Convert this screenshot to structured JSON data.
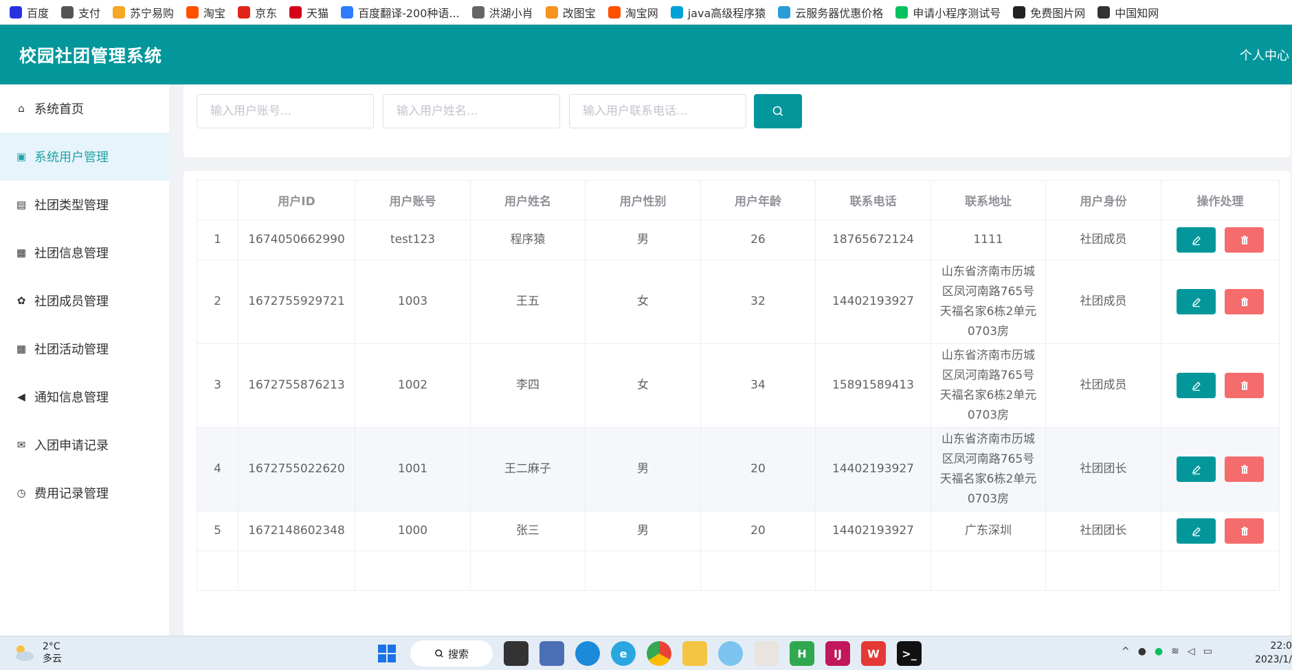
{
  "bookmarks": [
    {
      "label": "百度",
      "icon": "baidu-paw-icon",
      "color": "#2932e1"
    },
    {
      "label": "支付",
      "icon": "globe-icon",
      "color": "#555555"
    },
    {
      "label": "苏宁易购",
      "icon": "suning-icon",
      "color": "#f5a623"
    },
    {
      "label": "淘宝",
      "icon": "taobao-icon",
      "color": "#ff5000"
    },
    {
      "label": "京东",
      "icon": "jd-icon",
      "color": "#e1251b"
    },
    {
      "label": "天猫",
      "icon": "tmall-icon",
      "color": "#d8001a"
    },
    {
      "label": "百度翻译-200种语...",
      "icon": "translate-icon",
      "color": "#2f7bfd"
    },
    {
      "label": "洪湖小肖",
      "icon": "feather-icon",
      "color": "#666666"
    },
    {
      "label": "改图宝",
      "icon": "gaitubao-icon",
      "color": "#f7931e"
    },
    {
      "label": "淘宝网",
      "icon": "taobao-icon",
      "color": "#ff5000"
    },
    {
      "label": "java高级程序猿",
      "icon": "bilibili-icon",
      "color": "#00a1d6"
    },
    {
      "label": "云服务器优惠价格",
      "icon": "cloud-icon",
      "color": "#2b9cd8"
    },
    {
      "label": "申请小程序测试号",
      "icon": "wechat-icon",
      "color": "#07c160"
    },
    {
      "label": "免费图片网",
      "icon": "t-logo-icon",
      "color": "#222222"
    },
    {
      "label": "中国知网",
      "icon": "cnki-icon",
      "color": "#333333"
    }
  ],
  "header": {
    "title": "校园社团管理系统",
    "user_center": "个人中心"
  },
  "sidebar": {
    "items": [
      {
        "label": "系统首页",
        "icon": "home-icon",
        "active": false
      },
      {
        "label": "系统用户管理",
        "icon": "user-card-icon",
        "active": true
      },
      {
        "label": "社团类型管理",
        "icon": "document-icon",
        "active": false
      },
      {
        "label": "社团信息管理",
        "icon": "monitor-icon",
        "active": false
      },
      {
        "label": "社团成员管理",
        "icon": "users-icon",
        "active": false
      },
      {
        "label": "社团活动管理",
        "icon": "calendar-icon",
        "active": false
      },
      {
        "label": "通知信息管理",
        "icon": "megaphone-icon",
        "active": false
      },
      {
        "label": "入团申请记录",
        "icon": "envelope-icon",
        "active": false
      },
      {
        "label": "费用记录管理",
        "icon": "clock-icon",
        "active": false
      }
    ]
  },
  "search": {
    "account_placeholder": "输入用户账号...",
    "name_placeholder": "输入用户姓名...",
    "phone_placeholder": "输入用户联系电话..."
  },
  "table": {
    "headers": [
      "",
      "用户ID",
      "用户账号",
      "用户姓名",
      "用户性别",
      "用户年龄",
      "联系电话",
      "联系地址",
      "用户身份",
      "操作处理"
    ],
    "rows": [
      {
        "index": "1",
        "id": "1674050662990",
        "account": "test123",
        "name": "程序猿",
        "gender": "男",
        "age": "26",
        "phone": "18765672124",
        "address": "1111",
        "role": "社团成员"
      },
      {
        "index": "2",
        "id": "1672755929721",
        "account": "1003",
        "name": "王五",
        "gender": "女",
        "age": "32",
        "phone": "14402193927",
        "address": "山东省济南市历城区凤河南路765号天福名家6栋2单元0703房",
        "role": "社团成员"
      },
      {
        "index": "3",
        "id": "1672755876213",
        "account": "1002",
        "name": "李四",
        "gender": "女",
        "age": "34",
        "phone": "15891589413",
        "address": "山东省济南市历城区凤河南路765号天福名家6栋2单元0703房",
        "role": "社团成员"
      },
      {
        "index": "4",
        "id": "1672755022620",
        "account": "1001",
        "name": "王二麻子",
        "gender": "男",
        "age": "20",
        "phone": "14402193927",
        "address": "山东省济南市历城区凤河南路765号天福名家6栋2单元0703房",
        "role": "社团团长"
      },
      {
        "index": "5",
        "id": "1672148602348",
        "account": "1000",
        "name": "张三",
        "gender": "男",
        "age": "20",
        "phone": "14402193927",
        "address": "广东深圳",
        "role": "社团团长"
      }
    ]
  },
  "taskbar": {
    "temperature": "2°C",
    "weather": "多云",
    "search_label": "搜索",
    "time": "22:0",
    "date": "2023/1/"
  },
  "colors": {
    "primary": "#03979c",
    "danger": "#f56c6c",
    "active_bg": "#e8f4fb"
  }
}
